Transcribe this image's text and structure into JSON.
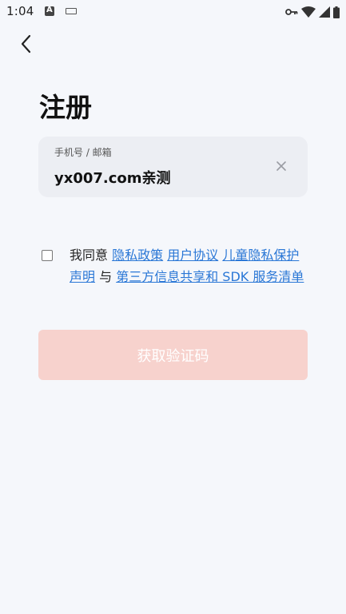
{
  "status_bar": {
    "time": "1:04",
    "icons": [
      "app-a-icon",
      "keyboard-icon",
      "vpn-key-icon",
      "wifi-icon",
      "cell-signal-icon",
      "battery-icon"
    ]
  },
  "header": {
    "back_icon": "chevron-left-icon"
  },
  "page": {
    "title": "注册"
  },
  "phone_field": {
    "label": "手机号 / 邮箱",
    "value": "yx007.com亲测",
    "clear_icon": "close-icon"
  },
  "agreement": {
    "prefix": "我同意",
    "links": [
      "隐私政策",
      "用户协议",
      "儿童隐私保护声明"
    ],
    "conjunction": "与",
    "last_link": "第三方信息共享和 SDK 服务清单"
  },
  "actions": {
    "get_code_label": "获取验证码"
  },
  "colors": {
    "background": "#f5f7fb",
    "link": "#2a77d6",
    "button_disabled": "#f7d2cd"
  }
}
